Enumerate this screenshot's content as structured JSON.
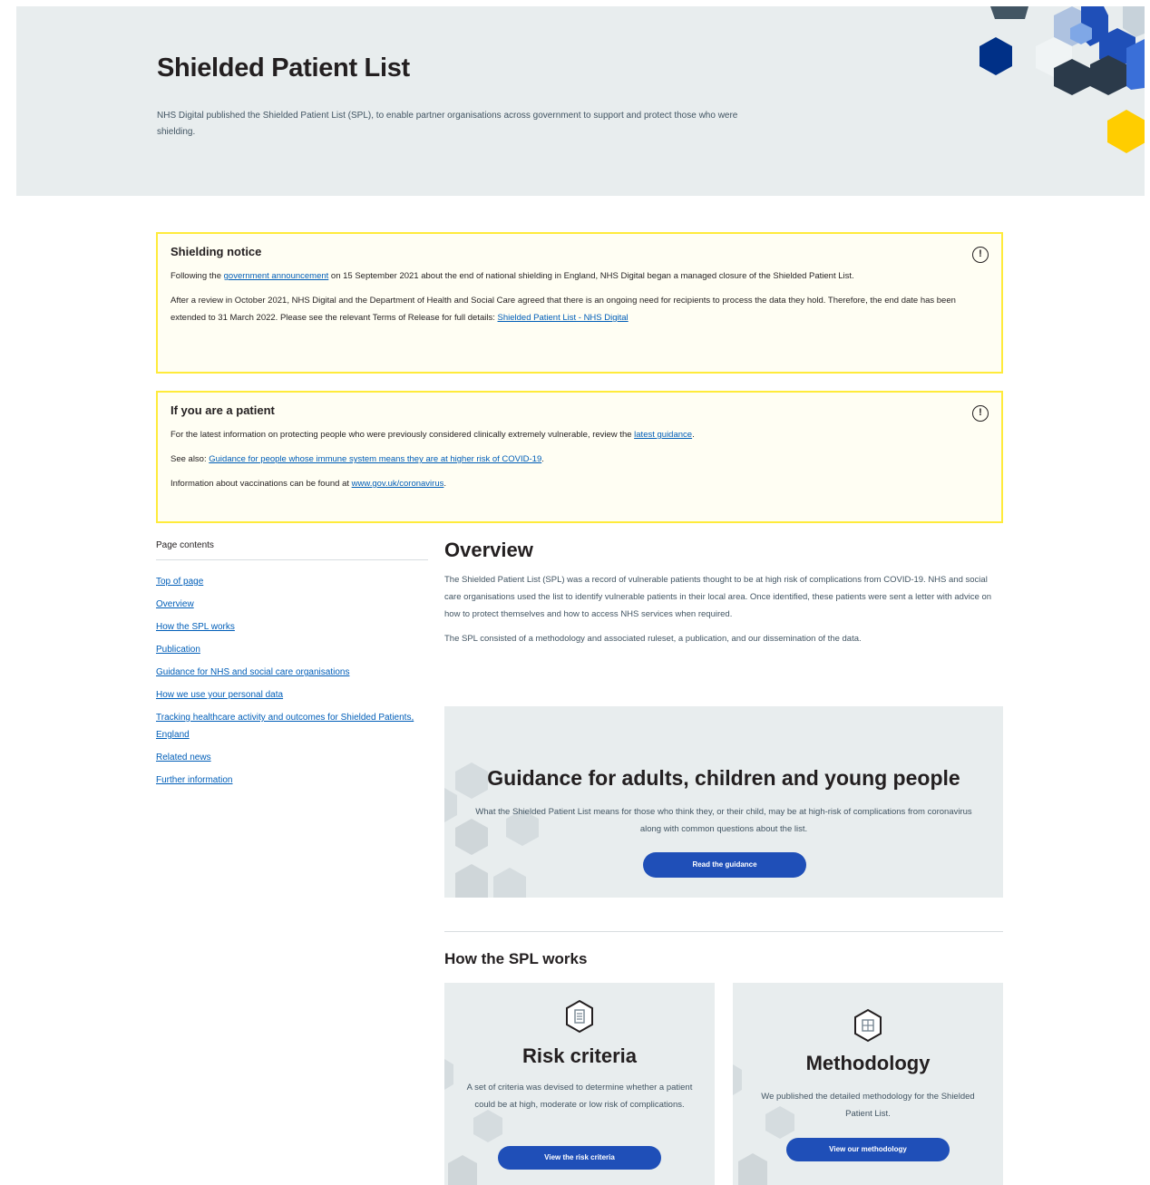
{
  "hero": {
    "title": "Shielded Patient List",
    "description": "NHS Digital published the Shielded Patient List (SPL), to enable partner organisations across government to support and protect those who were shielding."
  },
  "shielding_notice": {
    "title": "Shielding notice",
    "p1_before": "Following the ",
    "p1_link": "government announcement",
    "p1_after": " on 15 September 2021 about the end of national shielding in England, NHS Digital began a managed closure of the Shielded Patient List.",
    "p2_text": "After a review in October 2021, NHS Digital and the Department of Health and Social Care agreed that there is an ongoing need for recipients to process the data they hold. Therefore, the end date has been extended to 31 March 2022. Please see the relevant Terms of Release for full details: ",
    "p2_link": "Shielded Patient List - NHS Digital"
  },
  "patient_notice": {
    "title": "If you are a patient",
    "p1_before": "For the latest information on protecting people who were previously considered clinically extremely vulnerable, review the ",
    "p1_link": "latest guidance",
    "p1_after": ".",
    "p2_before": "See also: ",
    "p2_link": "Guidance for people whose immune system means they are at higher risk of COVID-19",
    "p2_after": ".",
    "p3_before": "Information about vaccinations can be found at ",
    "p3_link": "www.gov.uk/coronavirus",
    "p3_after": "."
  },
  "page_contents": {
    "heading": "Page contents",
    "items": [
      "Top of page",
      "Overview",
      "How the SPL works",
      "Publication",
      "Guidance for NHS and social care organisations",
      "How we use your personal data",
      "Tracking healthcare activity and outcomes for Shielded Patients, England",
      "Related news",
      "Further information"
    ]
  },
  "overview": {
    "title": "Overview",
    "p1": "The Shielded Patient List (SPL) was a record of vulnerable patients thought to be at high risk of complications from COVID-19. NHS and social care organisations used the list to identify vulnerable patients in their local area. Once identified, these patients were sent a letter with advice on how to protect themselves and how to access NHS services when required.",
    "p2": "The SPL consisted of a methodology and associated ruleset, a publication, and our dissemination of the data."
  },
  "guidance_promo": {
    "title": "Guidance for adults, children and young people",
    "description": "What the Shielded Patient List means for those who think they, or their child, may be at high-risk of complications from coronavirus along with common questions about the list.",
    "button": "Read the guidance"
  },
  "how_spl_works": {
    "heading": "How the SPL works",
    "cards": [
      {
        "title": "Risk criteria",
        "description": "A set of criteria was devised to determine whether a patient could be at high, moderate or low risk of complications.",
        "button": "View the risk criteria",
        "icon": "hexagon-document-icon"
      },
      {
        "title": "Methodology",
        "description": "We published the detailed methodology for the Shielded Patient List.",
        "button": "View our methodology",
        "icon": "hexagon-grid-icon"
      }
    ]
  },
  "colors": {
    "hero_bg": "#e8edee",
    "notice_border": "#ffeb3b",
    "link": "#005eb8",
    "button": "#1f4fb8",
    "cube_navy": "#003087",
    "cube_blue": "#1f4fb8",
    "cube_yellow": "#ffcd00"
  }
}
